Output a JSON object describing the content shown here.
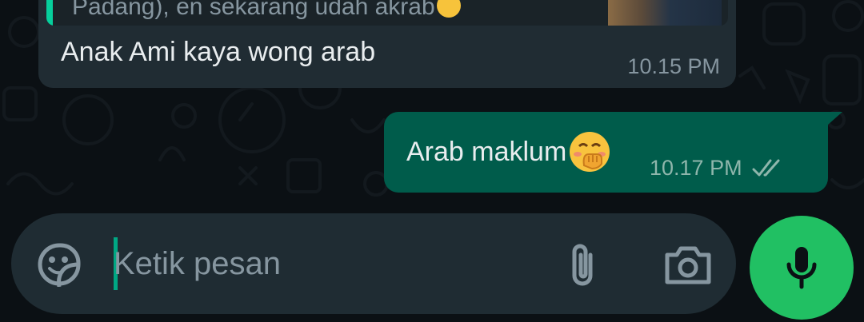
{
  "chat": {
    "incoming": {
      "quoted_text": "Padang), en sekarang udah akrab",
      "text": "Anak Ami kaya wong arab",
      "time": "10.15 PM"
    },
    "outgoing": {
      "text": "Arab maklum",
      "emoji": "hand-over-mouth",
      "time": "10.17 PM",
      "status": "double-check-delivered"
    }
  },
  "composer": {
    "placeholder": "Ketik pesan",
    "value": ""
  },
  "icons": {
    "sticker": "sticker-icon",
    "attach": "paperclip-icon",
    "camera": "camera-icon",
    "mic": "microphone-icon"
  },
  "colors": {
    "background": "#0b1014",
    "incoming_bubble": "#202c33",
    "outgoing_bubble": "#005c4b",
    "accent": "#00a884",
    "mic_button": "#21c063"
  }
}
